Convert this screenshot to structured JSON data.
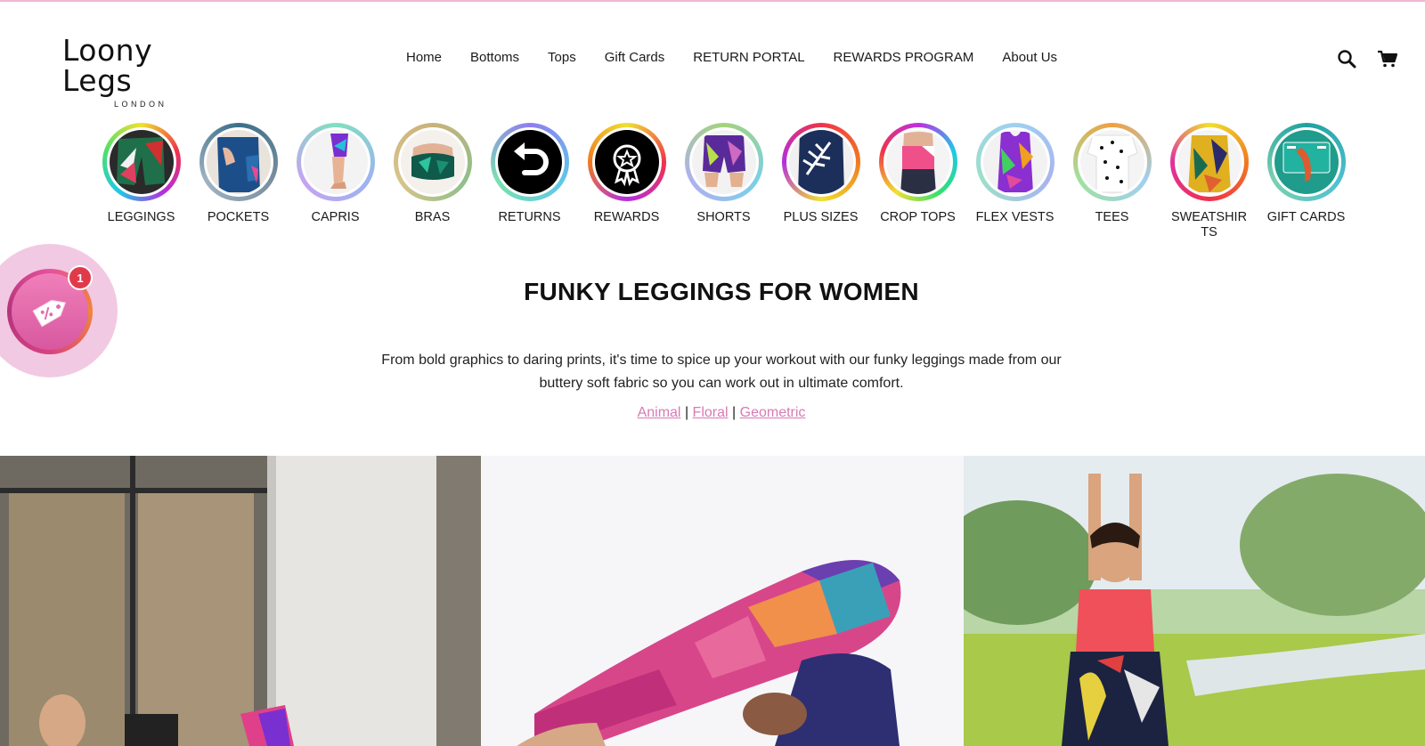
{
  "brand": {
    "name": "Loony Legs",
    "subtitle": "LONDON"
  },
  "nav": {
    "items": [
      "Home",
      "Bottoms",
      "Tops",
      "Gift Cards",
      "RETURN PORTAL",
      "REWARDS PROGRAM",
      "About Us"
    ]
  },
  "header_icons": [
    "search-icon",
    "cart-icon"
  ],
  "categories": [
    {
      "label": "LEGGINGS"
    },
    {
      "label": "POCKETS"
    },
    {
      "label": "CAPRIS"
    },
    {
      "label": "BRAS"
    },
    {
      "label": "RETURNS"
    },
    {
      "label": "REWARDS"
    },
    {
      "label": "SHORTS"
    },
    {
      "label": "PLUS SIZES"
    },
    {
      "label": "CROP TOPS"
    },
    {
      "label": "FLEX VESTS"
    },
    {
      "label": "TEES"
    },
    {
      "label": "SWEATSHIRTS"
    },
    {
      "label": "GIFT CARDS"
    }
  ],
  "promo_widget": {
    "badge_count": "1",
    "icon": "discount-tag-icon"
  },
  "main": {
    "title": "FUNKY LEGGINGS FOR WOMEN",
    "description": "From bold graphics to daring prints, it's time to spice up your workout with our funky leggings made from our buttery soft fabric so you can work out in ultimate comfort.",
    "links": [
      {
        "label": "Animal"
      },
      {
        "label": "Floral"
      },
      {
        "label": "Geometric"
      }
    ],
    "separator": "|"
  },
  "colors": {
    "accent_pink": "#d87ab5",
    "promo_bg": "#f2c9e2",
    "badge_red": "#e03a4a",
    "top_strip": "#f0b6d6"
  }
}
